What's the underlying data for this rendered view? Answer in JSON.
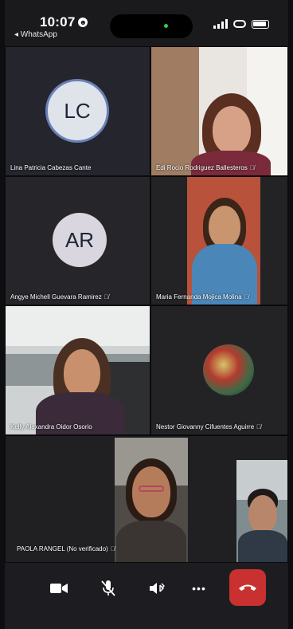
{
  "status_bar": {
    "time": "10:07",
    "back_app": "◂ WhatsApp"
  },
  "participants": [
    {
      "name": "Lina Patricia Cabezas Cante",
      "initials": "LC",
      "muted": false,
      "type": "avatar"
    },
    {
      "name": "Edi Rocio Rodriguez Ballesteros",
      "muted": true,
      "type": "video"
    },
    {
      "name": "Angye Michell Guevara Ramirez",
      "initials": "AR",
      "muted": true,
      "type": "avatar"
    },
    {
      "name": "Maria Fernanda Mojica Molina",
      "muted": true,
      "type": "video"
    },
    {
      "name": "Kelly Alexandra Oidor Osorio",
      "muted": false,
      "type": "video"
    },
    {
      "name": "Nestor Giovanny Cifuentes Aguirre",
      "muted": true,
      "type": "picture"
    },
    {
      "name": "PAOLA RANGEL  (No verificado)",
      "muted": true,
      "type": "video"
    }
  ],
  "mute_glyph": "🎙̸",
  "colors": {
    "avatar_lc_bg": "#dfe3ea",
    "avatar_lc_ring": "#6a7fb8",
    "avatar_ar_bg": "#d9d6df",
    "hangup": "#c8312f",
    "background": "#141417"
  },
  "controls": {
    "camera_icon": "video-camera-icon",
    "mic_icon": "microphone-muted-icon",
    "speaker_icon": "speaker-bluetooth-icon",
    "more_label": "•••",
    "end_icon": "end-call-icon"
  }
}
